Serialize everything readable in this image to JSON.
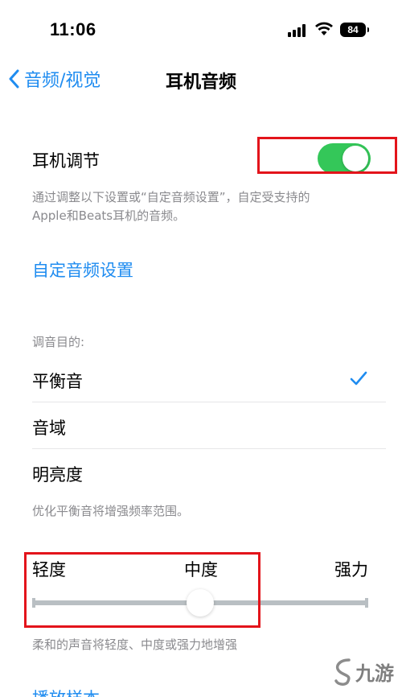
{
  "status_bar": {
    "time": "11:06",
    "battery": "84"
  },
  "nav": {
    "back_label": "音频/视觉",
    "title": "耳机音频"
  },
  "headphone": {
    "label": "耳机调节",
    "enabled": true,
    "description_line1": "通过调整以下设置或“自定音频设置”，自定受支持的",
    "description_line2": "Apple和Beats耳机的音频。"
  },
  "custom_audio_link": "自定音频设置",
  "tune_for": {
    "header": "调音目的:",
    "options": [
      {
        "label": "平衡音",
        "selected": true
      },
      {
        "label": "音域",
        "selected": false
      },
      {
        "label": "明亮度",
        "selected": false
      }
    ],
    "footer": "优化平衡音将增强频率范围。"
  },
  "strength": {
    "labels": [
      "轻度",
      "中度",
      "强力"
    ],
    "value": 0.5,
    "footer": "柔和的声音将轻度、中度或强力地增强"
  },
  "cut_off_row": "播放样本",
  "watermark": "九游",
  "colors": {
    "accent": "#1f8cf0",
    "toggle_on": "#34c759",
    "highlight_box": "#e3141b"
  }
}
